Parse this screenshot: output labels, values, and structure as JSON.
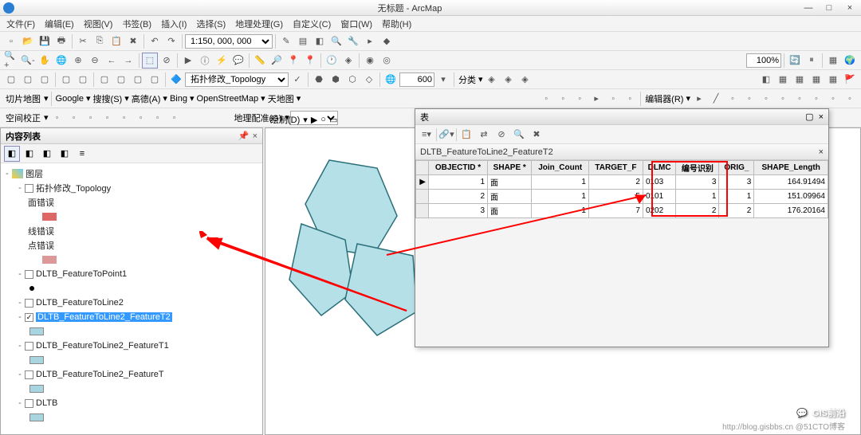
{
  "window": {
    "title": "无标题 - ArcMap"
  },
  "menu": [
    "文件(F)",
    "编辑(E)",
    "视图(V)",
    "书签(B)",
    "插入(I)",
    "选择(S)",
    "地理处理(G)",
    "自定义(C)",
    "窗口(W)",
    "帮助(H)"
  ],
  "toolbar1": {
    "scale": "1:150, 000, 000"
  },
  "toolbar2": {
    "zoom": "100%"
  },
  "toolbar3": {
    "topology": "拓扑修改_Topology",
    "val": "600",
    "classify": "分类"
  },
  "toolbar4": {
    "label": "切片地图",
    "items": [
      "Google",
      "搜搜(S)",
      "高德(A)",
      "Bing",
      "OpenStreetMap",
      "天地图"
    ],
    "editor": "编辑器(R)"
  },
  "toolbar5": {
    "spatial": "空间校正",
    "geomatch": "地理配准(G)",
    "draw": "绘制(D)"
  },
  "toc": {
    "title": "内容列表",
    "root": "图层",
    "items": [
      {
        "label": "拓扑修改_Topology",
        "indent": 1,
        "tw": "-",
        "cb": false
      },
      {
        "label": "面错误",
        "indent": 2
      },
      {
        "sym": "#d66",
        "indent": 3
      },
      {
        "label": "线错误",
        "indent": 2
      },
      {
        "label": "点错误",
        "indent": 2
      },
      {
        "sym": "#d99",
        "indent": 3
      },
      {
        "label": "DLTB_FeatureToPoint1",
        "indent": 1,
        "tw": "-",
        "cb": false
      },
      {
        "sym": "#000",
        "indent": 2,
        "dot": true
      },
      {
        "label": "DLTB_FeatureToLine2",
        "indent": 1,
        "tw": "-",
        "cb": false
      },
      {
        "label": "DLTB_FeatureToLine2_FeatureT2",
        "indent": 1,
        "tw": "-",
        "cb": true,
        "sel": true
      },
      {
        "sym": "#a9d5e0",
        "indent": 2,
        "box": true
      },
      {
        "label": "DLTB_FeatureToLine2_FeatureT1",
        "indent": 1,
        "tw": "-",
        "cb": false
      },
      {
        "sym": "#a9d5e0",
        "indent": 2,
        "box": true
      },
      {
        "label": "DLTB_FeatureToLine2_FeatureT",
        "indent": 1,
        "tw": "-",
        "cb": false
      },
      {
        "sym": "#a9d5e0",
        "indent": 2,
        "box": true
      },
      {
        "label": "DLTB",
        "indent": 1,
        "tw": "-",
        "cb": false
      },
      {
        "sym": "#a9d5e0",
        "indent": 2,
        "box": true
      }
    ]
  },
  "table": {
    "wintitle": "表",
    "tabname": "DLTB_FeatureToLine2_FeatureT2",
    "headers": [
      "",
      "OBJECTID *",
      "SHAPE *",
      "Join_Count",
      "TARGET_F",
      "DLMC",
      "编号识别",
      "ORIG_",
      "SHAPE_Length"
    ],
    "rows": [
      [
        "▶",
        "1",
        "面",
        "1",
        "2",
        "0103",
        "3",
        "3",
        "164.91494"
      ],
      [
        "",
        "2",
        "面",
        "1",
        "5",
        "0101",
        "1",
        "1",
        "151.09964"
      ],
      [
        "",
        "3",
        "面",
        "1",
        "7",
        "0202",
        "2",
        "2",
        "176.20164"
      ]
    ]
  },
  "watermark": "GIS前沿",
  "watermark2": "http://blog.gisbbs.cn @51CTO博客"
}
